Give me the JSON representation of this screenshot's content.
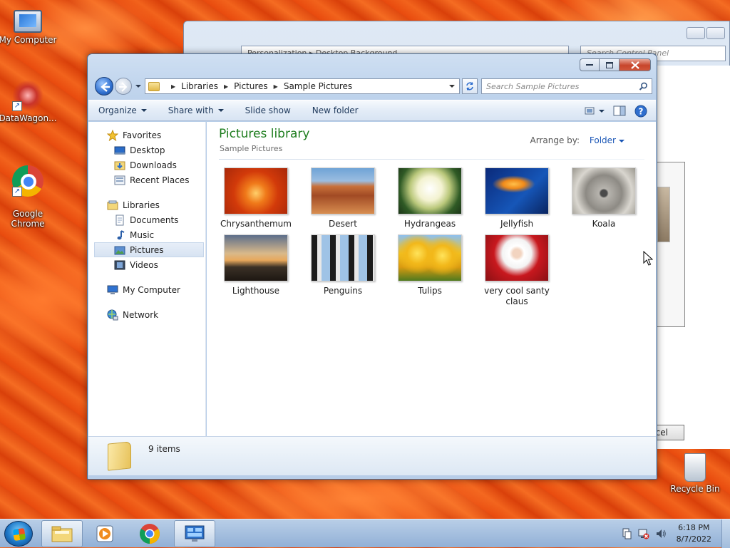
{
  "desktop": {
    "icons": [
      {
        "label": "My Computer"
      },
      {
        "label": "DataWagon..."
      },
      {
        "label": "Google\nChrome"
      },
      {
        "label": "Recycle Bin"
      }
    ]
  },
  "bg_window": {
    "address": "Personalization  ▸  Desktop Background",
    "search_placeholder": "Search Control Panel",
    "cancel_label": "ncel"
  },
  "window": {
    "address": {
      "crumbs": [
        "Libraries",
        "Pictures",
        "Sample Pictures"
      ]
    },
    "search_placeholder": "Search Sample Pictures",
    "toolbar": {
      "organize": "Organize",
      "share_with": "Share with",
      "slide_show": "Slide show",
      "new_folder": "New folder"
    },
    "sidebar": {
      "favorites": "Favorites",
      "desktop": "Desktop",
      "downloads": "Downloads",
      "recent_places": "Recent Places",
      "libraries": "Libraries",
      "documents": "Documents",
      "music": "Music",
      "pictures": "Pictures",
      "videos": "Videos",
      "my_computer": "My Computer",
      "network": "Network"
    },
    "content": {
      "title": "Pictures library",
      "subtitle": "Sample Pictures",
      "arrange_label": "Arrange by:",
      "arrange_value": "Folder",
      "items": [
        {
          "name": "Chrysanthemum"
        },
        {
          "name": "Desert"
        },
        {
          "name": "Hydrangeas"
        },
        {
          "name": "Jellyfish"
        },
        {
          "name": "Koala"
        },
        {
          "name": "Lighthouse"
        },
        {
          "name": "Penguins"
        },
        {
          "name": "Tulips"
        },
        {
          "name": "very cool santy claus"
        }
      ]
    },
    "details": {
      "count": "9 items"
    }
  },
  "taskbar": {
    "time": "6:18 PM",
    "date": "8/7/2022"
  }
}
